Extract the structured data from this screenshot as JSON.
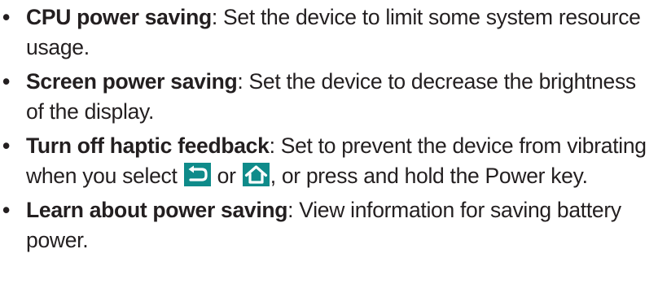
{
  "items": [
    {
      "bullet": "•",
      "term": "CPU power saving",
      "desc": ": Set the device to limit some system resource usage."
    },
    {
      "bullet": "•",
      "term": "Screen power saving",
      "desc": ": Set the device to decrease the brightness of the display."
    },
    {
      "bullet": "•",
      "term": "Turn off haptic feedback",
      "desc_before": ": Set to prevent the device from vibrating when you select ",
      "desc_between": " or ",
      "desc_after": ", or press and hold the Power key.",
      "icons": [
        "back-icon",
        "home-icon"
      ]
    },
    {
      "bullet": "•",
      "term": "Learn about power saving",
      "desc": ": View information for saving battery power."
    }
  ],
  "colors": {
    "text": "#231f20",
    "icon_bg": "#0f8b8a",
    "icon_fg": "#ffffff"
  }
}
